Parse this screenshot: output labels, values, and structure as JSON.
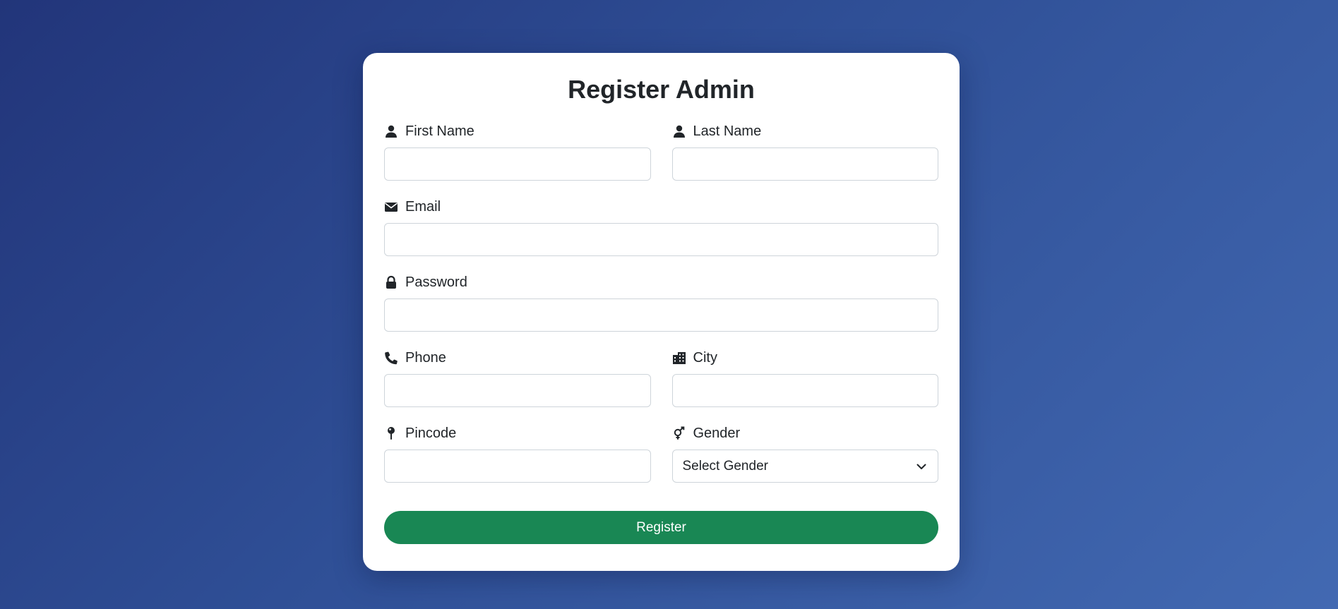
{
  "form": {
    "title": "Register Admin",
    "fields": {
      "first_name": {
        "label": "First Name",
        "icon": "user-icon",
        "value": "",
        "placeholder": ""
      },
      "last_name": {
        "label": "Last Name",
        "icon": "user-icon",
        "value": "",
        "placeholder": ""
      },
      "email": {
        "label": "Email",
        "icon": "envelope-icon",
        "value": "",
        "placeholder": ""
      },
      "password": {
        "label": "Password",
        "icon": "lock-icon",
        "value": "",
        "placeholder": ""
      },
      "phone": {
        "label": "Phone",
        "icon": "phone-icon",
        "value": "",
        "placeholder": ""
      },
      "city": {
        "label": "City",
        "icon": "city-icon",
        "value": "",
        "placeholder": ""
      },
      "pincode": {
        "label": "Pincode",
        "icon": "map-pin-icon",
        "value": "",
        "placeholder": ""
      },
      "gender": {
        "label": "Gender",
        "icon": "venus-mars-icon",
        "selected": "Select Gender"
      }
    },
    "submit_label": "Register"
  },
  "colors": {
    "background_start": "#22357a",
    "background_end": "#4269b2",
    "card": "#ffffff",
    "button": "#198754",
    "text": "#212529",
    "input_border": "#ced4da"
  }
}
